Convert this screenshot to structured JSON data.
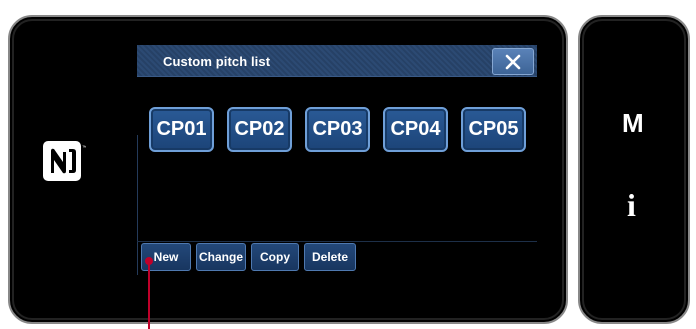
{
  "dialog": {
    "title": "Custom pitch list",
    "close_icon": "close-icon"
  },
  "pitch_buttons": [
    {
      "label": "CP01"
    },
    {
      "label": "CP02"
    },
    {
      "label": "CP03"
    },
    {
      "label": "CP04"
    },
    {
      "label": "CP05"
    }
  ],
  "footer": {
    "new_label": "New",
    "change_label": "Change",
    "copy_label": "Copy",
    "delete_label": "Delete"
  },
  "side_keys": {
    "m_label": "M",
    "i_label": "i"
  },
  "colors": {
    "titlebar": "#2c4a73",
    "button_fill": "#2a5a96",
    "button_border": "#6f9fd8",
    "callout": "#c0002a"
  },
  "icons": {
    "nfc": "nfc-logo-icon",
    "close": "close-icon"
  }
}
